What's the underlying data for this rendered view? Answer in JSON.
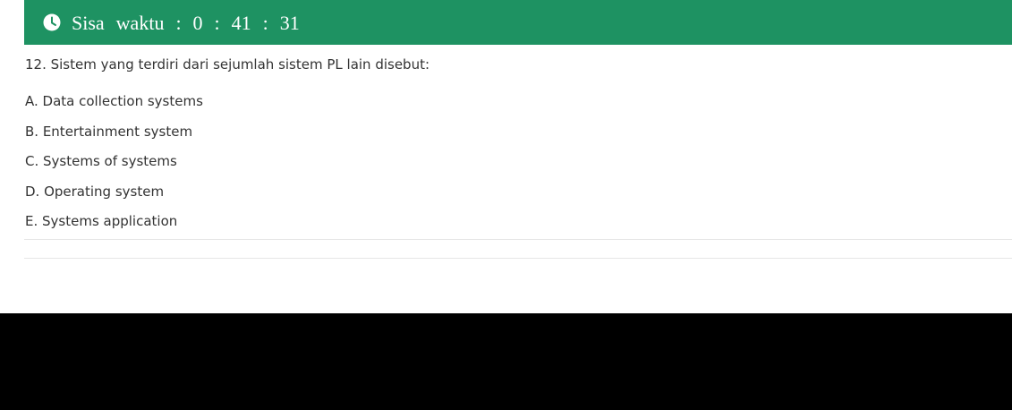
{
  "timer": {
    "label": "Sisa  waktu  :  0  :  41  :  31",
    "icon": "clock-icon",
    "bar_color": "#1e9262"
  },
  "question": {
    "text": "12. Sistem yang terdiri dari sejumlah sistem PL lain disebut:"
  },
  "options": [
    {
      "label": "A. Data collection systems"
    },
    {
      "label": "B. Entertainment system"
    },
    {
      "label": "C. Systems of systems"
    },
    {
      "label": "D. Operating system"
    },
    {
      "label": "E. Systems application"
    }
  ]
}
